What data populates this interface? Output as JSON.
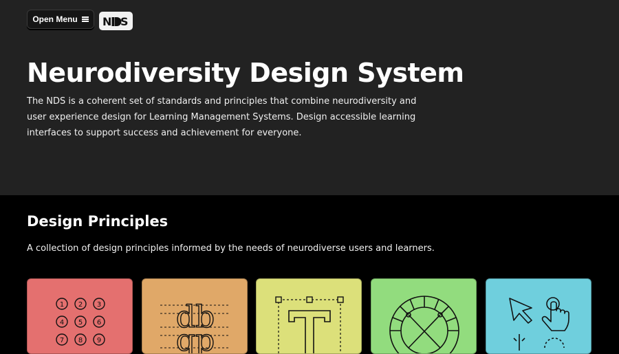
{
  "header": {
    "menu_label": "Open Menu",
    "logo_text": "NDS"
  },
  "hero": {
    "title": "Neurodiversity Design System",
    "description": "The NDS is a coherent set of standards and principles that combine neurodiversity and user experience design for Learning Management Systems. Design accessible learning interfaces to support success and achievement for everyone."
  },
  "principles": {
    "title": "Design Principles",
    "subtitle": "A collection of design principles informed by the needs of neurodiverse users and learners.",
    "cards": [
      {
        "icon": "number-grid-icon",
        "color": "#e4706f",
        "numbers": [
          "1",
          "2",
          "3",
          "4",
          "5",
          "6",
          "7",
          "8",
          "9"
        ]
      },
      {
        "icon": "typography-icon",
        "color": "#e0a868",
        "glyphs_top": "db",
        "glyphs_bottom": "qp"
      },
      {
        "icon": "text-box-icon",
        "color": "#dce07a",
        "glyph": "T"
      },
      {
        "icon": "color-wheel-icon",
        "color": "#92dc7e"
      },
      {
        "icon": "pointer-icon",
        "color": "#6fcfdd"
      }
    ]
  },
  "colors": {
    "hero_bg": "#222222",
    "page_bg": "#000000"
  }
}
